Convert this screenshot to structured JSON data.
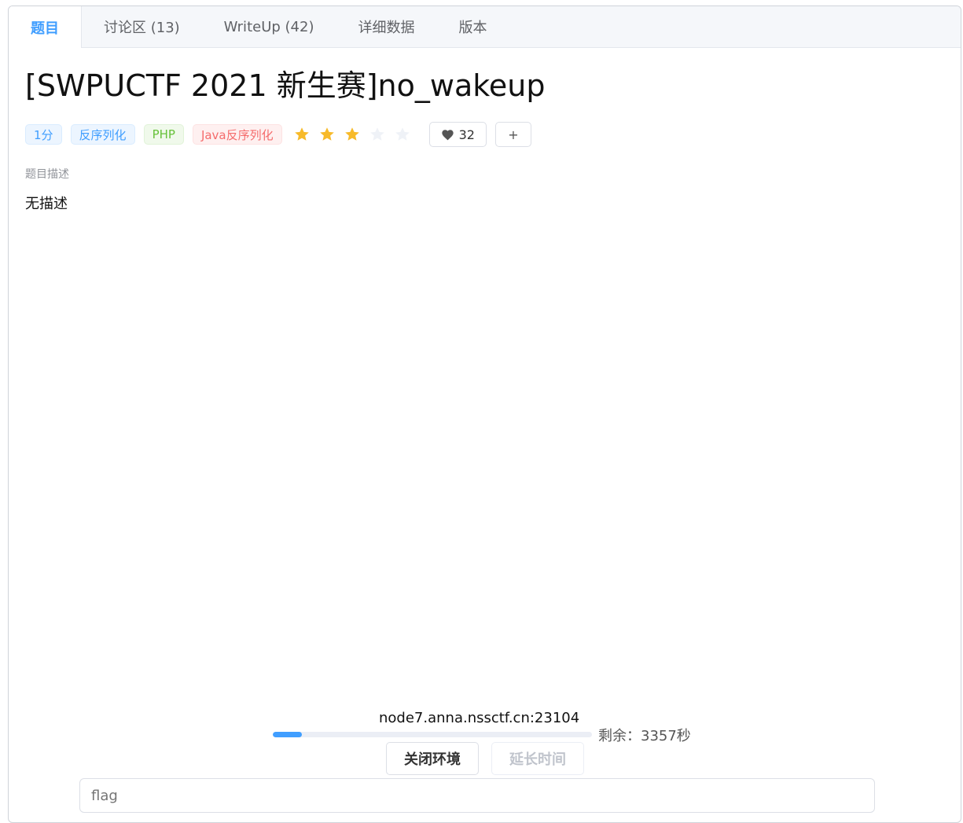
{
  "tabs": [
    {
      "label": "题目",
      "active": true
    },
    {
      "label": "讨论区 (13)",
      "active": false
    },
    {
      "label": "WriteUp (42)",
      "active": false
    },
    {
      "label": "详细数据",
      "active": false
    },
    {
      "label": "版本",
      "active": false
    }
  ],
  "problem": {
    "title": "[SWPUCTF 2021 新生赛]no_wakeup",
    "tags": [
      {
        "label": "1分",
        "color": "blue"
      },
      {
        "label": "反序列化",
        "color": "blue"
      },
      {
        "label": "PHP",
        "color": "green"
      },
      {
        "label": "Java反序列化",
        "color": "red"
      }
    ],
    "rating": {
      "filled": 3,
      "total": 5
    },
    "likes": "32",
    "add_label": "+",
    "description_label": "题目描述",
    "description": "无描述"
  },
  "environment": {
    "address": "node7.anna.nssctf.cn:23104",
    "progress_fraction": 0.09,
    "remaining": "剩余：3357秒",
    "close_label": "关闭环境",
    "extend_label": "延长时间"
  },
  "flag_input": {
    "placeholder": "flag"
  },
  "colors": {
    "accent": "#409eff",
    "star_filled": "#f7ba2a",
    "star_empty": "#eff2f7"
  }
}
